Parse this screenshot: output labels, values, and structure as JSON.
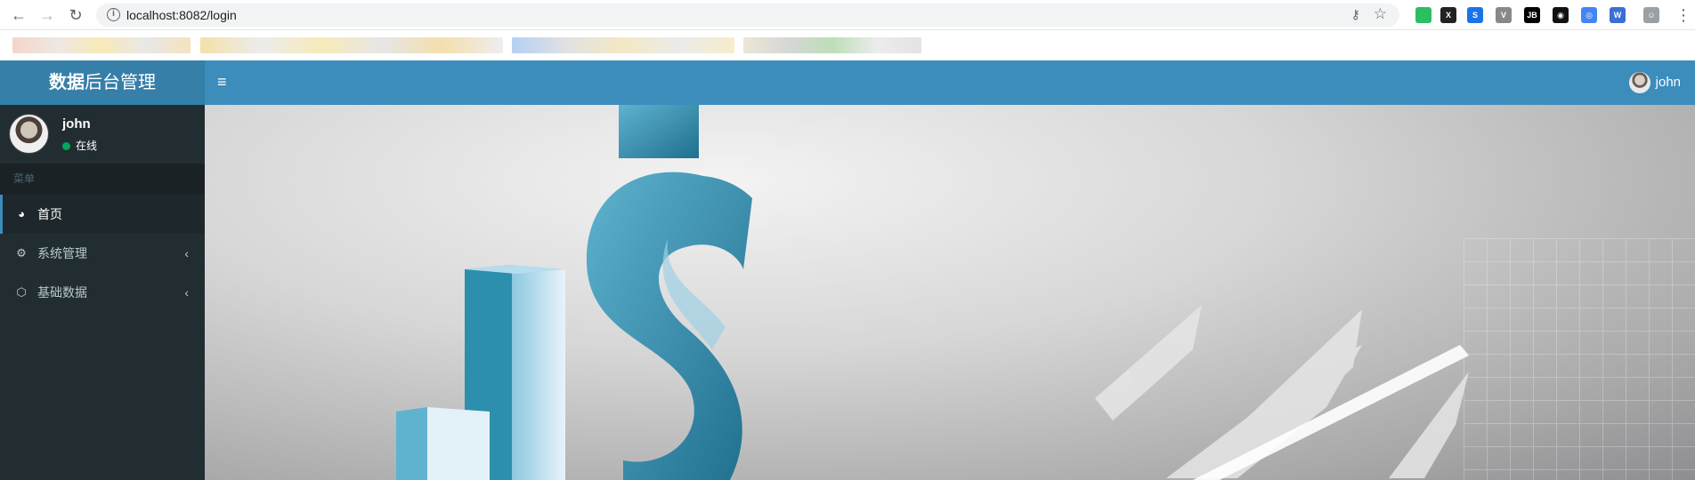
{
  "browser": {
    "url": "localhost:8082/login",
    "extensions": [
      {
        "name": "evernote-icon",
        "color": "#2dbe60",
        "label": ""
      },
      {
        "name": "x-extension-icon",
        "color": "#222222",
        "label": "X"
      },
      {
        "name": "s-new-extension-icon",
        "color": "#1a73e8",
        "label": "S"
      },
      {
        "name": "vue-devtools-icon",
        "color": "#888888",
        "label": "V"
      },
      {
        "name": "jb-extension-icon",
        "color": "#000000",
        "label": "JB"
      },
      {
        "name": "ghost-extension-icon",
        "color": "#111111",
        "label": "◉"
      },
      {
        "name": "chrome-extension-icon",
        "color": "#4285f4",
        "label": "◎"
      },
      {
        "name": "w-extension-icon",
        "color": "#3b6fd6",
        "label": "W"
      },
      {
        "name": "profile-avatar-icon",
        "color": "#9aa0a6",
        "label": "☺"
      }
    ]
  },
  "app": {
    "logo_bold": "数据",
    "logo_rest": "后台管理",
    "top_user": "john"
  },
  "sidebar": {
    "user_name": "john",
    "user_status": "在线",
    "header": "菜单",
    "items": [
      {
        "label": "首页",
        "icon": "dashboard-icon",
        "active": true
      },
      {
        "label": "系统管理",
        "icon": "cogs-icon",
        "active": false
      },
      {
        "label": "基础数据",
        "icon": "cube-icon",
        "active": false
      }
    ]
  },
  "colors": {
    "topbar": "#3c8dbc",
    "logo_bg": "#367fa9",
    "sidebar_bg": "#222d32",
    "sidebar_header": "#1a2226"
  }
}
